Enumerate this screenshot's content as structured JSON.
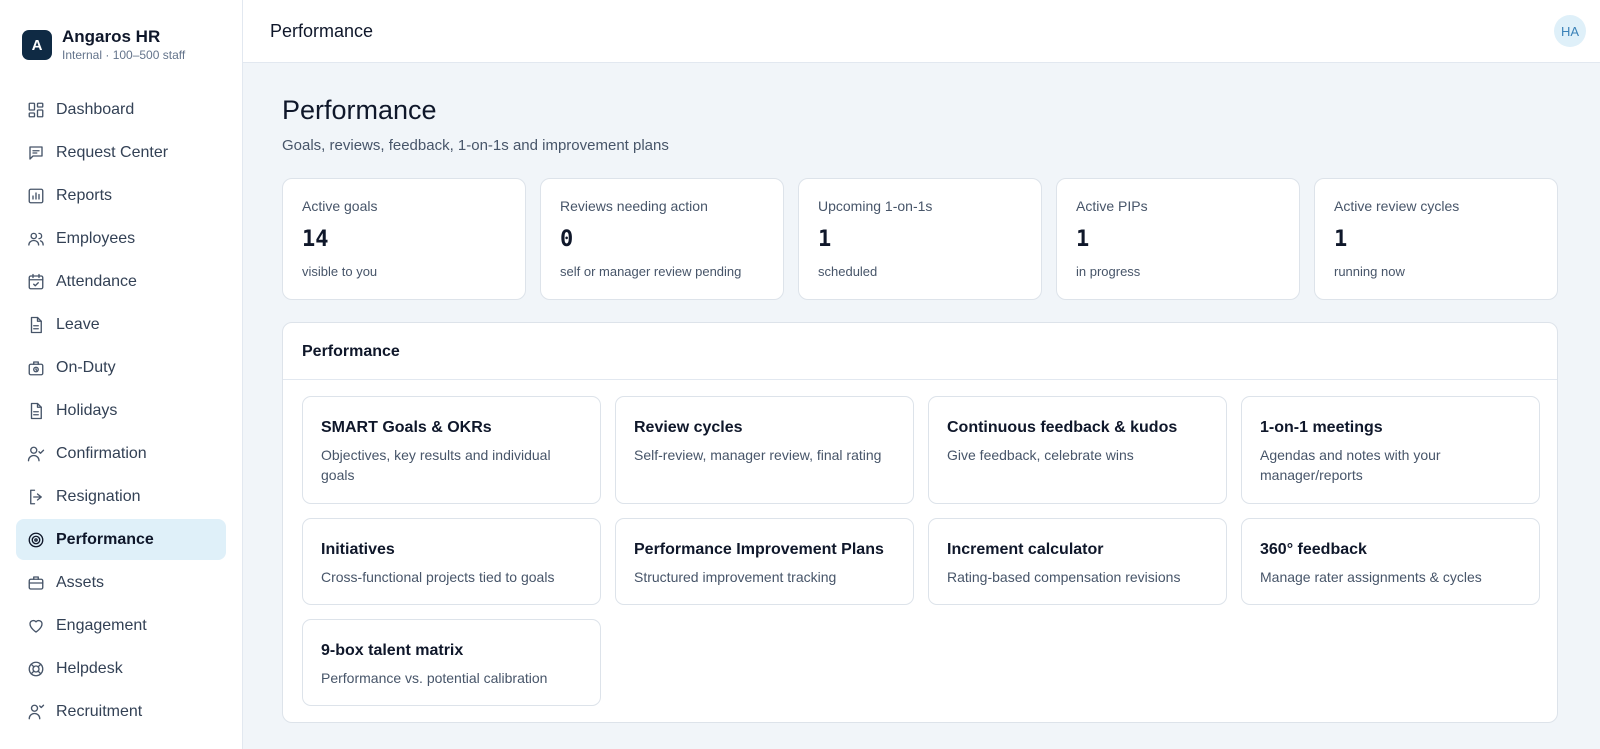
{
  "brand": {
    "logo_letter": "A",
    "name": "Angaros HR",
    "sub": "Internal · 100–500 staff"
  },
  "sidebar": {
    "items": [
      {
        "label": "Dashboard",
        "icon": "dashboard-icon"
      },
      {
        "label": "Request Center",
        "icon": "message-icon"
      },
      {
        "label": "Reports",
        "icon": "bar-chart-icon"
      },
      {
        "label": "Employees",
        "icon": "users-icon"
      },
      {
        "label": "Attendance",
        "icon": "calendar-check-icon"
      },
      {
        "label": "Leave",
        "icon": "document-icon"
      },
      {
        "label": "On-Duty",
        "icon": "briefcase-clock-icon"
      },
      {
        "label": "Holidays",
        "icon": "document-icon"
      },
      {
        "label": "Confirmation",
        "icon": "user-check-icon"
      },
      {
        "label": "Resignation",
        "icon": "logout-icon"
      },
      {
        "label": "Performance",
        "icon": "target-icon",
        "active": true
      },
      {
        "label": "Assets",
        "icon": "briefcase-icon"
      },
      {
        "label": "Engagement",
        "icon": "heart-icon"
      },
      {
        "label": "Helpdesk",
        "icon": "lifebuoy-icon"
      },
      {
        "label": "Recruitment",
        "icon": "user-plus-icon"
      }
    ]
  },
  "header": {
    "title": "Performance",
    "avatar": "HA"
  },
  "page": {
    "title": "Performance",
    "subtitle": "Goals, reviews, feedback, 1-on-1s and improvement plans"
  },
  "stats": [
    {
      "label": "Active goals",
      "value": "14",
      "note": "visible to you"
    },
    {
      "label": "Reviews needing action",
      "value": "0",
      "note": "self or manager review pending"
    },
    {
      "label": "Upcoming 1-on-1s",
      "value": "1",
      "note": "scheduled"
    },
    {
      "label": "Active PIPs",
      "value": "1",
      "note": "in progress"
    },
    {
      "label": "Active review cycles",
      "value": "1",
      "note": "running now"
    }
  ],
  "panel": {
    "title": "Performance",
    "tiles": [
      {
        "title": "SMART Goals & OKRs",
        "desc": "Objectives, key results and individual goals"
      },
      {
        "title": "Review cycles",
        "desc": "Self-review, manager review, final rating"
      },
      {
        "title": "Continuous feedback & kudos",
        "desc": "Give feedback, celebrate wins"
      },
      {
        "title": "1-on-1 meetings",
        "desc": "Agendas and notes with your manager/reports"
      },
      {
        "title": "Initiatives",
        "desc": "Cross-functional projects tied to goals"
      },
      {
        "title": "Performance Improvement Plans",
        "desc": "Structured improvement tracking"
      },
      {
        "title": "Increment calculator",
        "desc": "Rating-based compensation revisions"
      },
      {
        "title": "360° feedback",
        "desc": "Manage rater assignments & cycles"
      },
      {
        "title": "9-box talent matrix",
        "desc": "Performance vs. potential calibration"
      }
    ]
  },
  "colors": {
    "accent_bg": "#dff0f9",
    "brand": "#0f2a44",
    "page_bg": "#f1f5f9"
  }
}
